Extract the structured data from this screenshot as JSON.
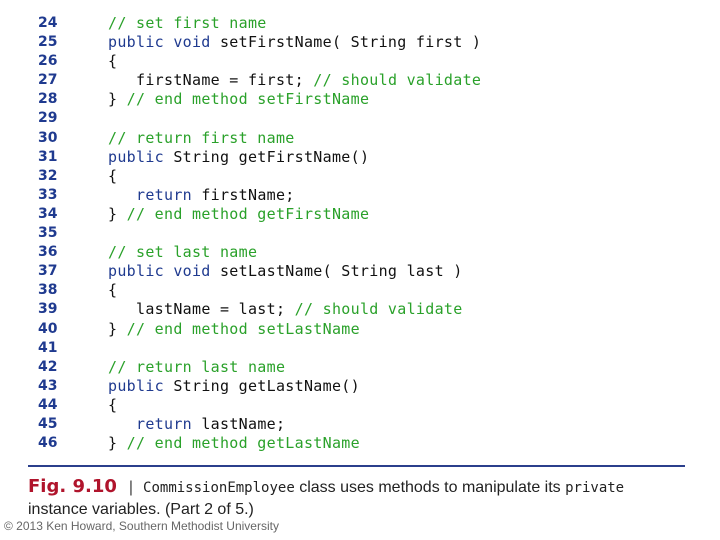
{
  "code_lines": [
    {
      "num": "24",
      "indent": "",
      "parts": [
        {
          "t": "// set first name",
          "c": "cm"
        }
      ]
    },
    {
      "num": "25",
      "indent": "",
      "parts": [
        {
          "t": "public void",
          "c": "kw"
        },
        {
          "t": " setFirstName( String first )",
          "c": ""
        }
      ]
    },
    {
      "num": "26",
      "indent": "",
      "parts": [
        {
          "t": "{",
          "c": ""
        }
      ]
    },
    {
      "num": "27",
      "indent": "   ",
      "parts": [
        {
          "t": "firstName = first; ",
          "c": ""
        },
        {
          "t": "// should validate",
          "c": "cm"
        }
      ]
    },
    {
      "num": "28",
      "indent": "",
      "parts": [
        {
          "t": "} ",
          "c": ""
        },
        {
          "t": "// end method setFirstName",
          "c": "cm"
        }
      ]
    },
    {
      "num": "29",
      "indent": "",
      "parts": []
    },
    {
      "num": "30",
      "indent": "",
      "parts": [
        {
          "t": "// return first name",
          "c": "cm"
        }
      ]
    },
    {
      "num": "31",
      "indent": "",
      "parts": [
        {
          "t": "public",
          "c": "kw"
        },
        {
          "t": " String getFirstName()",
          "c": ""
        }
      ]
    },
    {
      "num": "32",
      "indent": "",
      "parts": [
        {
          "t": "{",
          "c": ""
        }
      ]
    },
    {
      "num": "33",
      "indent": "   ",
      "parts": [
        {
          "t": "return",
          "c": "kw"
        },
        {
          "t": " firstName;",
          "c": ""
        }
      ]
    },
    {
      "num": "34",
      "indent": "",
      "parts": [
        {
          "t": "} ",
          "c": ""
        },
        {
          "t": "// end method getFirstName",
          "c": "cm"
        }
      ]
    },
    {
      "num": "35",
      "indent": "",
      "parts": []
    },
    {
      "num": "36",
      "indent": "",
      "parts": [
        {
          "t": "// set last name",
          "c": "cm"
        }
      ]
    },
    {
      "num": "37",
      "indent": "",
      "parts": [
        {
          "t": "public void",
          "c": "kw"
        },
        {
          "t": " setLastName( String last )",
          "c": ""
        }
      ]
    },
    {
      "num": "38",
      "indent": "",
      "parts": [
        {
          "t": "{",
          "c": ""
        }
      ]
    },
    {
      "num": "39",
      "indent": "   ",
      "parts": [
        {
          "t": "lastName = last; ",
          "c": ""
        },
        {
          "t": "// should validate",
          "c": "cm"
        }
      ]
    },
    {
      "num": "40",
      "indent": "",
      "parts": [
        {
          "t": "} ",
          "c": ""
        },
        {
          "t": "// end method setLastName",
          "c": "cm"
        }
      ]
    },
    {
      "num": "41",
      "indent": "",
      "parts": []
    },
    {
      "num": "42",
      "indent": "",
      "parts": [
        {
          "t": "// return last name",
          "c": "cm"
        }
      ]
    },
    {
      "num": "43",
      "indent": "",
      "parts": [
        {
          "t": "public",
          "c": "kw"
        },
        {
          "t": " String getLastName()",
          "c": ""
        }
      ]
    },
    {
      "num": "44",
      "indent": "",
      "parts": [
        {
          "t": "{",
          "c": ""
        }
      ]
    },
    {
      "num": "45",
      "indent": "   ",
      "parts": [
        {
          "t": "return",
          "c": "kw"
        },
        {
          "t": " lastName;",
          "c": ""
        }
      ]
    },
    {
      "num": "46",
      "indent": "",
      "parts": [
        {
          "t": "} ",
          "c": ""
        },
        {
          "t": "// end method getLastName",
          "c": "cm"
        }
      ]
    }
  ],
  "caption": {
    "fig_label": "Fig. 9.10",
    "separator": "|",
    "class_name": "CommissionEmployee",
    "text_1": " class uses methods to manipulate its ",
    "keyword": "private",
    "text_2": "instance variables. (Part 2 of 5.)"
  },
  "copyright": "© 2013 Ken Howard, Southern Methodist University",
  "colors": {
    "line_number": "#1f3a8f",
    "keyword": "#1f3a8f",
    "comment": "#2aa12a",
    "fig_label": "#b0142c",
    "divider": "#2b3f8c"
  }
}
